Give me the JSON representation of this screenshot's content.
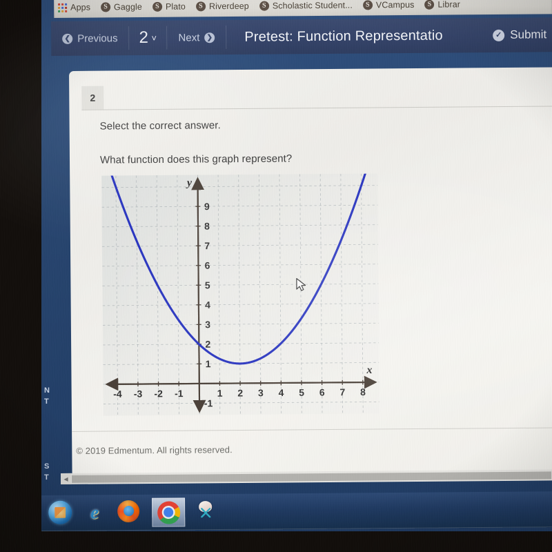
{
  "browser": {
    "bookmarks": [
      {
        "label": "Apps",
        "icon": "apps-grid-icon"
      },
      {
        "label": "Gaggle",
        "icon": "bookmark-globe-icon"
      },
      {
        "label": "Plato",
        "icon": "bookmark-globe-icon"
      },
      {
        "label": "Riverdeep",
        "icon": "bookmark-globe-icon"
      },
      {
        "label": "Scholastic Student...",
        "icon": "bookmark-globe-icon"
      },
      {
        "label": "VCampus",
        "icon": "bookmark-globe-icon"
      },
      {
        "label": "Librar",
        "icon": "bookmark-globe-icon"
      }
    ]
  },
  "navbar": {
    "previous_label": "Previous",
    "previous_icon": "arrow-left-circle-icon",
    "question_number": "2",
    "question_chevron": "˅",
    "next_label": "Next",
    "next_icon": "arrow-right-circle-icon",
    "title": "Pretest: Function Representatio",
    "submit_label": "Submit",
    "submit_icon": "check-circle-icon"
  },
  "question": {
    "number_badge": "2",
    "instruction": "Select the correct answer.",
    "prompt": "What function does this graph represent?"
  },
  "footer": {
    "copyright": "© 2019 Edmentum. All rights reserved."
  },
  "scrollbar": {
    "left_arrow": "◀"
  },
  "side_strip": {
    "labels": [
      "N",
      "T",
      "S",
      "T"
    ]
  },
  "taskbar": {
    "items": [
      {
        "name": "start-orb",
        "icon": "windows-start-icon"
      },
      {
        "name": "internet-explorer",
        "icon": "internet-explorer-icon"
      },
      {
        "name": "firefox",
        "icon": "firefox-icon"
      },
      {
        "name": "chrome",
        "icon": "chrome-icon",
        "active": true
      },
      {
        "name": "snipping-tool",
        "icon": "snipping-tool-icon"
      }
    ]
  },
  "cursor": {
    "icon": "mouse-pointer-icon",
    "graph_x": 4.8,
    "graph_y": 5.3
  },
  "chart_data": {
    "type": "line",
    "title": "",
    "xlabel": "x",
    "ylabel": "y",
    "grid": true,
    "legend": null,
    "xlim": [
      -4.7,
      8.8
    ],
    "ylim": [
      -1.6,
      10.6
    ],
    "xticks": [
      -4,
      -3,
      -2,
      -1,
      1,
      2,
      3,
      4,
      5,
      6,
      7,
      8
    ],
    "yticks": [
      9,
      8,
      7,
      6,
      5,
      4,
      3,
      2,
      1,
      -1
    ],
    "curve_color": "#2733c0",
    "axis_color": "#4a4038",
    "grid_color": "#9aa3a8",
    "equation": "y = (1/4)(x - 2)^2 + 1",
    "vertex": [
      2,
      1
    ],
    "y_intercept": 2,
    "x": [
      -4.6,
      -4,
      -3,
      -2,
      -1,
      0,
      1,
      2,
      3,
      4,
      5,
      6,
      7,
      8,
      8.7
    ],
    "y": [
      11.9,
      10.0,
      7.25,
      5.0,
      3.25,
      2.0,
      1.25,
      1.0,
      1.25,
      2.0,
      3.25,
      5.0,
      7.25,
      10.0,
      12.2
    ]
  }
}
